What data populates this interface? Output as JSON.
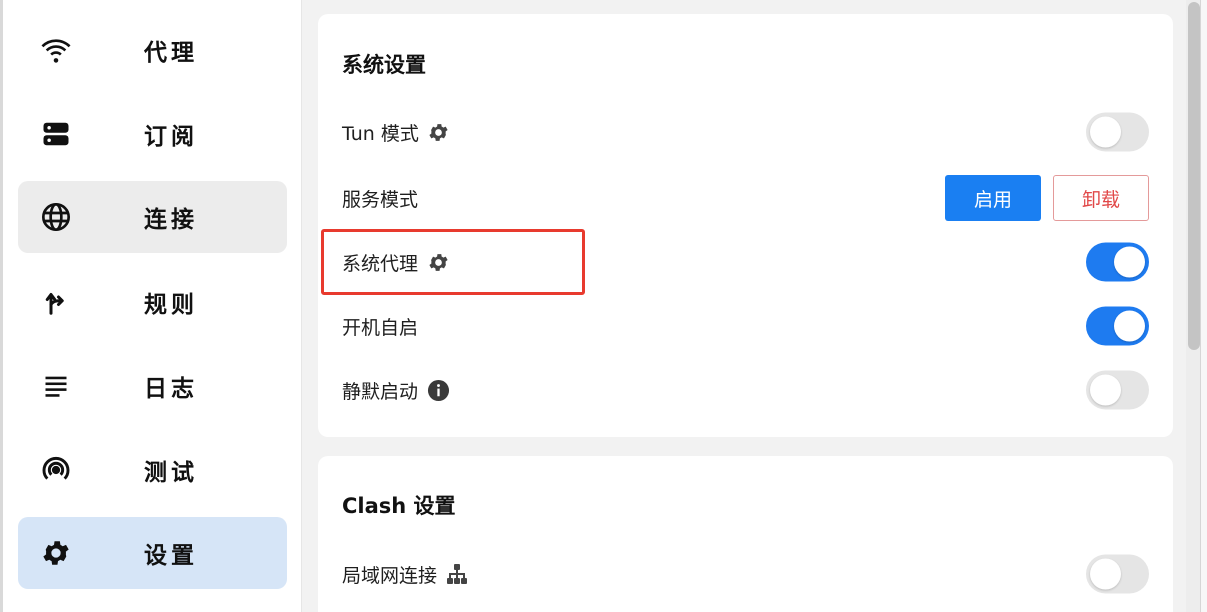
{
  "sidebar": {
    "items": [
      {
        "label": "代理",
        "icon": "wifi-icon"
      },
      {
        "label": "订阅",
        "icon": "server-icon"
      },
      {
        "label": "连接",
        "icon": "globe-icon"
      },
      {
        "label": "规则",
        "icon": "fork-arrow-icon"
      },
      {
        "label": "日志",
        "icon": "lines-icon"
      },
      {
        "label": "测试",
        "icon": "broadcast-icon"
      },
      {
        "label": "设置",
        "icon": "gear-icon"
      }
    ]
  },
  "system_settings": {
    "title": "系统设置",
    "rows": [
      {
        "label": "Tun 模式",
        "icon": "gear-icon",
        "enabled": false
      },
      {
        "label": "服务模式",
        "primary_btn": "启用",
        "danger_btn": "卸载"
      },
      {
        "label": "系统代理",
        "icon": "gear-icon",
        "enabled": true
      },
      {
        "label": "开机自启",
        "enabled": true
      },
      {
        "label": "静默启动",
        "icon": "info-icon",
        "enabled": false
      }
    ]
  },
  "clash_settings": {
    "title": "Clash 设置",
    "rows": [
      {
        "label": "局域网连接",
        "icon": "network-icon",
        "enabled": false
      }
    ]
  },
  "colors": {
    "accent": "#1e7bf0",
    "danger": "#e14848",
    "highlight": "#e83a2e",
    "active_nav": "#d6e5f7"
  }
}
